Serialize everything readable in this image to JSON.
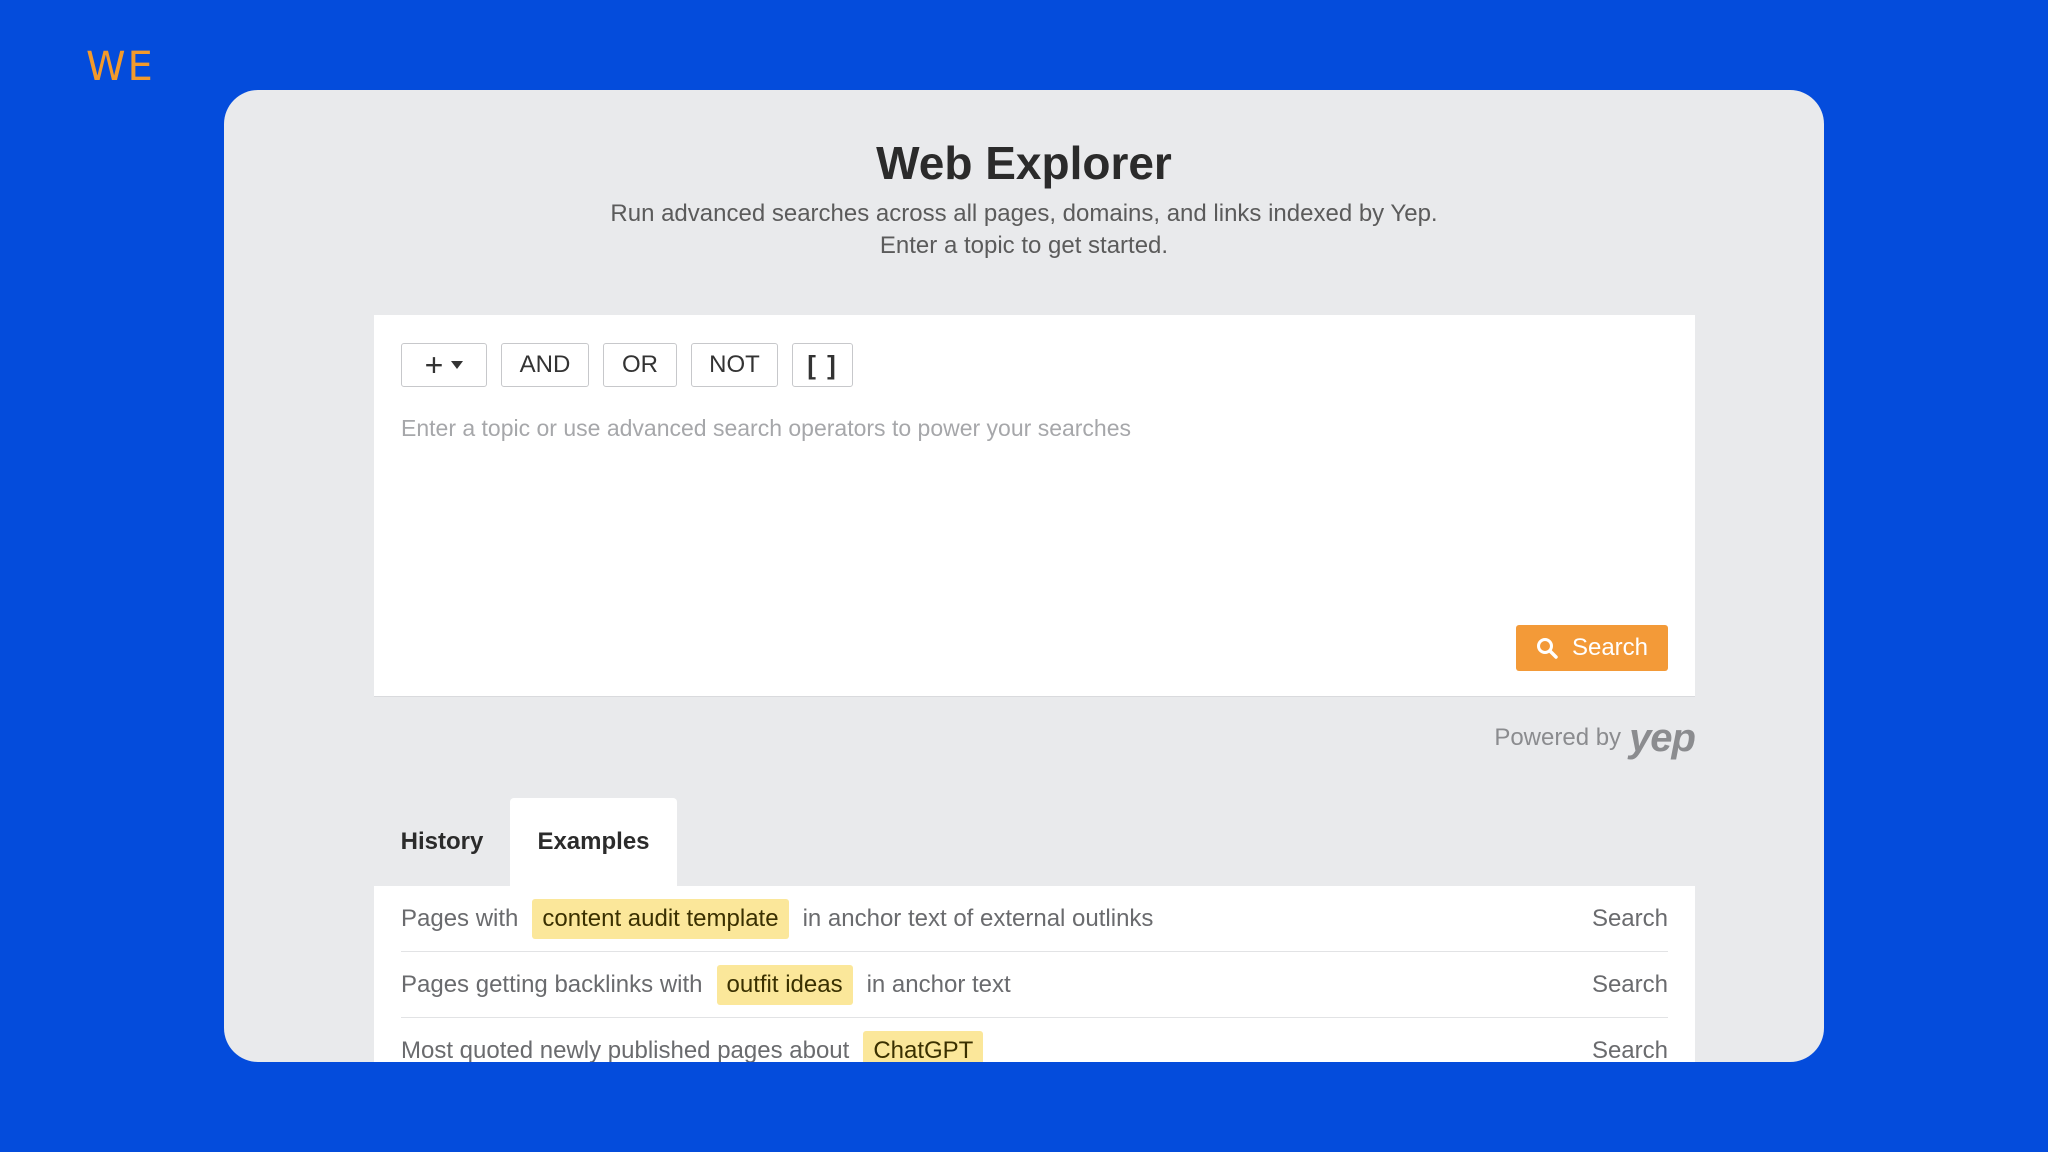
{
  "brand": "WE",
  "header": {
    "title": "Web Explorer",
    "subtitle_line1": "Run advanced searches across all pages, domains, and links indexed by Yep.",
    "subtitle_line2": "Enter a topic to get started."
  },
  "operators": {
    "plus": "+",
    "and": "AND",
    "or": "OR",
    "not": "NOT",
    "brackets": "[ ]"
  },
  "query": {
    "placeholder": "Enter a topic or use advanced search operators to power your searches",
    "value": ""
  },
  "search_button": {
    "label": "Search",
    "icon": "search-icon"
  },
  "powered": {
    "prefix": "Powered by",
    "logo": "yep"
  },
  "tabs": [
    {
      "label": "History",
      "active": false
    },
    {
      "label": "Examples",
      "active": true
    }
  ],
  "examples": [
    {
      "before": "Pages with",
      "highlight": "content audit template",
      "after": "in anchor text of external outlinks",
      "action": "Search"
    },
    {
      "before": "Pages getting backlinks with",
      "highlight": "outfit ideas",
      "after": "in anchor text",
      "action": "Search"
    },
    {
      "before": "Most quoted newly published pages about",
      "highlight": "ChatGPT",
      "after": "",
      "action": "Search"
    }
  ],
  "colors": {
    "background": "#044cdc",
    "brand": "#f39a2b",
    "accent": "#f39a38",
    "highlight": "#fbe79a"
  }
}
